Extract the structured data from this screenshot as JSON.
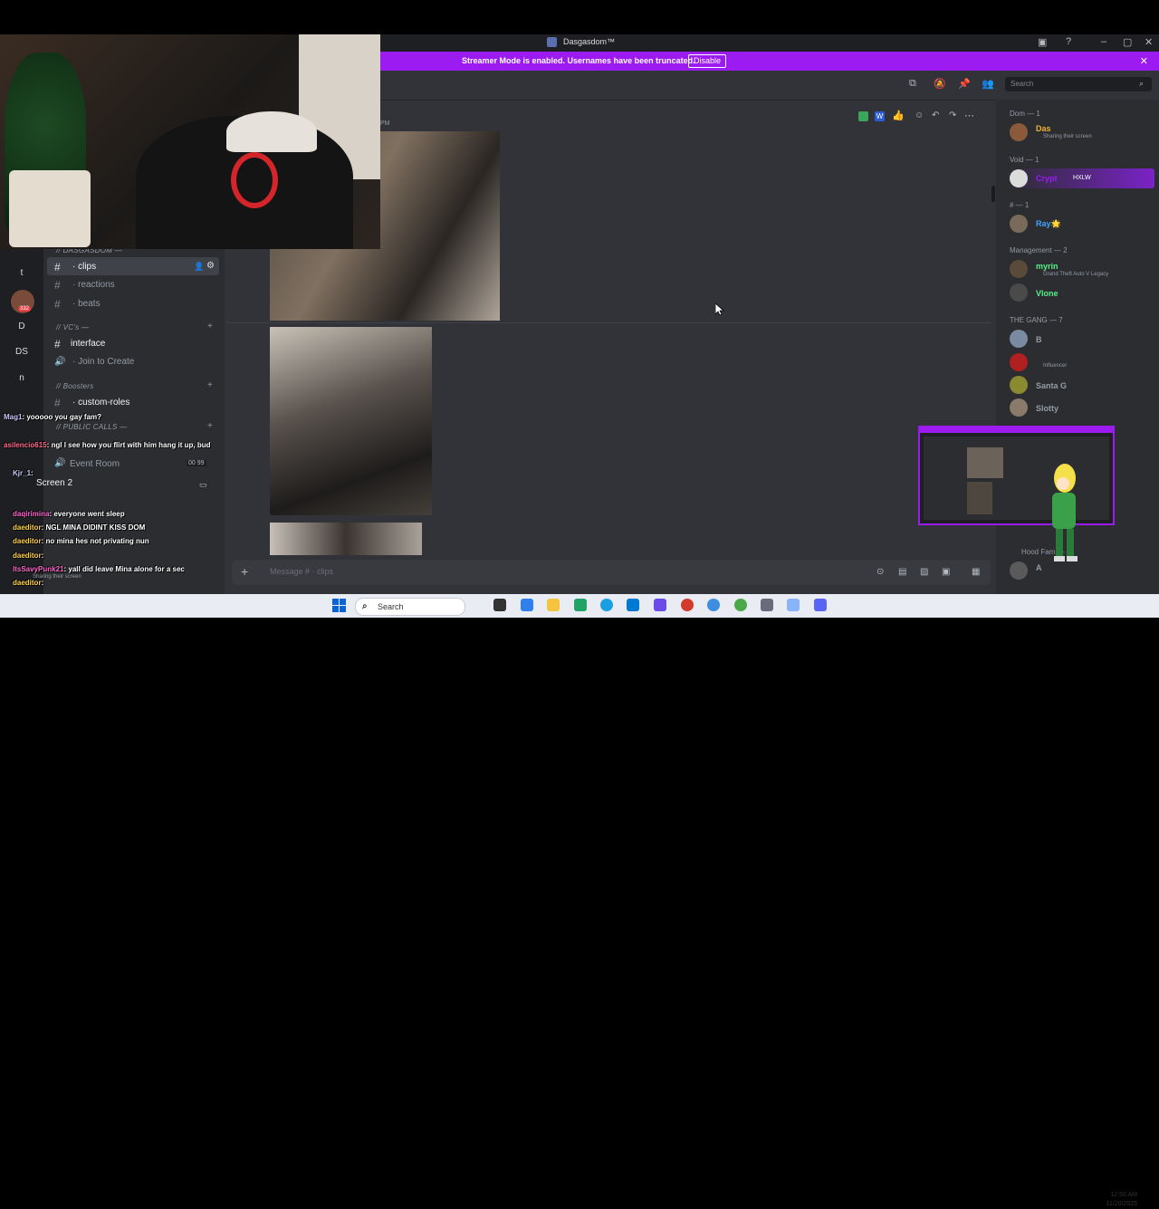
{
  "window": {
    "title": "Dasgasdom™"
  },
  "banner": {
    "text": "Streamer Mode is enabled. Usernames have been truncated.",
    "button": "Disable"
  },
  "search": {
    "placeholder": "Search"
  },
  "server_name": "// DASGASDOM —",
  "channels": [
    {
      "label": "· clips",
      "selected": true
    },
    {
      "label": "· reactions"
    },
    {
      "label": "· beats"
    }
  ],
  "categories": {
    "vcs": "// VC's —",
    "boosters": "// Boosters",
    "public_calls": "// PUBLIC CALLS —"
  },
  "voice": {
    "interface": "interface",
    "join": "· Join to Create",
    "custom_roles": "· custom-roles",
    "event_room": "Event Room",
    "event_counts": "00  99",
    "screen": "Screen 2"
  },
  "guilds": [
    "t",
    "D",
    "DS",
    "n"
  ],
  "guild_badge": "332",
  "message_input": {
    "placeholder": "Message # · clips"
  },
  "timestamp_stub": "PM",
  "members": {
    "groups": [
      {
        "label": "Dom — 1",
        "members": [
          {
            "name": "Das",
            "sub": "Sharing their screen",
            "color": "#f0b232"
          }
        ]
      },
      {
        "label": "Void — 1",
        "members": [
          {
            "name": "Crypt",
            "badge": "HXLW",
            "color": "#9b1bf0"
          }
        ]
      },
      {
        "label": "# — 1",
        "members": [
          {
            "name": "Ray🌟",
            "color": "#3ea6ff"
          }
        ]
      },
      {
        "label": "Management — 2",
        "members": [
          {
            "name": "myrin",
            "sub": "Grand Theft Auto V Legacy",
            "color": "#57f287"
          },
          {
            "name": "Vlone",
            "color": "#57f287"
          }
        ]
      },
      {
        "label": "THE GANG — 7",
        "members": [
          {
            "name": "B",
            "color": "#949ba4"
          },
          {
            "name": "",
            "sub": "Influencer",
            "color": "#949ba4"
          },
          {
            "name": "Santa G",
            "color": "#949ba4"
          },
          {
            "name": "Slotty",
            "color": "#949ba4"
          }
        ]
      },
      {
        "label": "Hood Fam — 2",
        "members": [
          {
            "name": "A",
            "color": "#949ba4"
          }
        ]
      }
    ]
  },
  "chat_overlay": [
    {
      "user": "Mag1",
      "text": ": yooooo you gay fam?"
    },
    {
      "user": "asilencio615",
      "text": ": ngl I see how you flirt with him hang it up, bud"
    },
    {
      "user": "Kjr_1",
      "text": ":"
    },
    {
      "user": "daqirimina",
      "text": ": everyone went sleep"
    },
    {
      "user": "daeditor",
      "text": ": NGL MINA DIDINT KISS DOM"
    },
    {
      "user": "daeditor",
      "text": ": no mina hes not privating nun"
    },
    {
      "user": "daeditor",
      "text": ":"
    },
    {
      "user": "ItsSavyPunk21",
      "text": ": yall did leave Mina alone for a sec"
    },
    {
      "user": "daeditor",
      "text": ":"
    }
  ],
  "overlay_user_label": "Sharing their screen",
  "taskbar": {
    "search": "Search",
    "time": "12:50 AM",
    "date": "11/20/2025"
  },
  "colors": {
    "accent": "#9b1bf0",
    "bg": "#313338",
    "sidebar": "#2b2d31",
    "taskbar": "#e9ecf2"
  }
}
